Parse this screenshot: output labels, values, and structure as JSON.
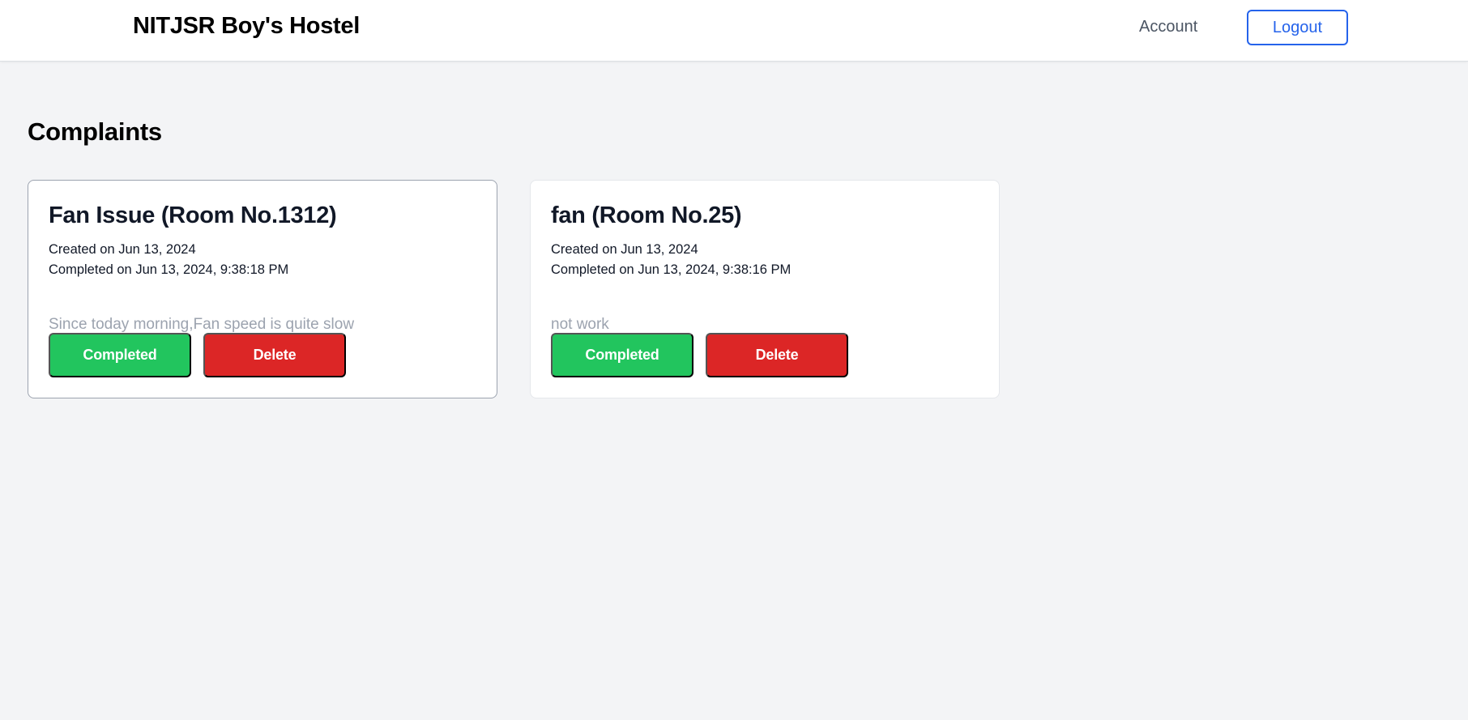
{
  "navbar": {
    "brand": "NITJSR Boy's Hostel",
    "account_label": "Account",
    "logout_label": "Logout"
  },
  "main": {
    "title": "Complaints",
    "complaints": [
      {
        "title": "Fan Issue (Room No.1312)",
        "created": "Created on Jun 13, 2024",
        "completed": "Completed on Jun 13, 2024, 9:38:18 PM",
        "description": "Since today morning,Fan speed is quite slow",
        "completed_label": "Completed",
        "delete_label": "Delete"
      },
      {
        "title": "fan (Room No.25)",
        "created": "Created on Jun 13, 2024",
        "completed": "Completed on Jun 13, 2024, 9:38:16 PM",
        "description": "not work",
        "completed_label": "Completed",
        "delete_label": "Delete"
      }
    ]
  },
  "colors": {
    "page_background": "#f3f4f6",
    "accent_blue": "#2563eb",
    "completed_green": "#22c55e",
    "delete_red": "#dc2626",
    "muted_text": "#9ca3af"
  }
}
